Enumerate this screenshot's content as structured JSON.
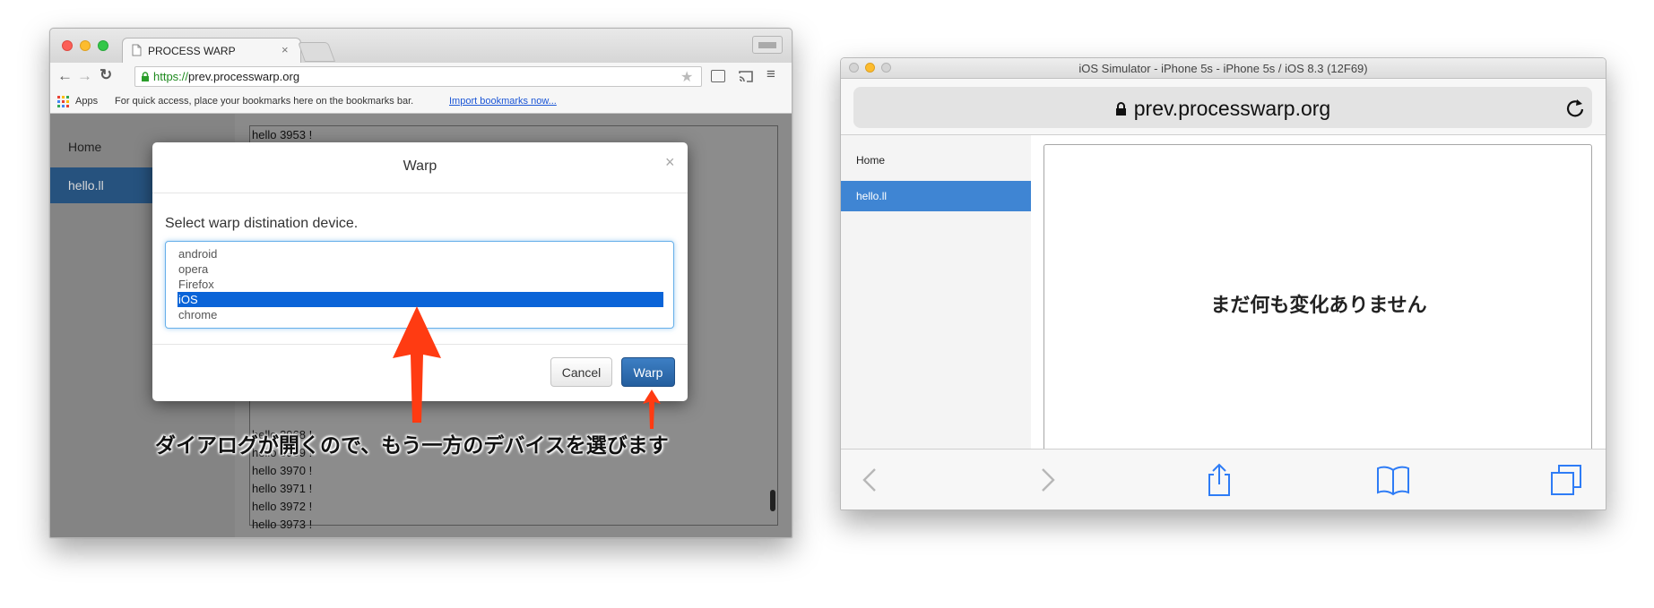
{
  "chrome": {
    "tab_title": "PROCESS WARP",
    "url_scheme": "https://",
    "url_host": "prev.processwarp.org",
    "bookmarks": {
      "apps_label": "Apps",
      "hint": "For quick access, place your bookmarks here on the bookmarks bar.",
      "import_link": "Import bookmarks now..."
    },
    "sidebar": {
      "items": [
        {
          "label": "Home"
        },
        {
          "label": "hello.ll"
        }
      ]
    },
    "log_lines": [
      "hello 3953 !",
      "hello 3968 !",
      "hello 3969 !",
      "hello 3970 !",
      "hello 3971 !",
      "hello 3972 !",
      "hello 3973 !"
    ],
    "dialog": {
      "title": "Warp",
      "close_glyph": "×",
      "prompt": "Select warp distination device.",
      "devices": [
        "android",
        "opera",
        "Firefox",
        "iOS",
        "chrome"
      ],
      "selected_device": "iOS",
      "cancel_label": "Cancel",
      "warp_label": "Warp"
    }
  },
  "annotation": {
    "text": "ダイアログが開くので、もう一方のデバイスを選びます",
    "arrow_color": "#ff3b12"
  },
  "ios": {
    "window_title": "iOS Simulator - iPhone 5s - iPhone 5s / iOS 8.3 (12F69)",
    "url": "prev.processwarp.org",
    "sidebar": {
      "items": [
        {
          "label": "Home"
        },
        {
          "label": "hello.ll"
        }
      ]
    },
    "message": "まだ何も変化ありません"
  },
  "colors": {
    "active_nav": "#3f85d3",
    "selection": "#0a64d8",
    "primary_button": "#2f6fb3",
    "ios_tint": "#2e7cf6"
  }
}
